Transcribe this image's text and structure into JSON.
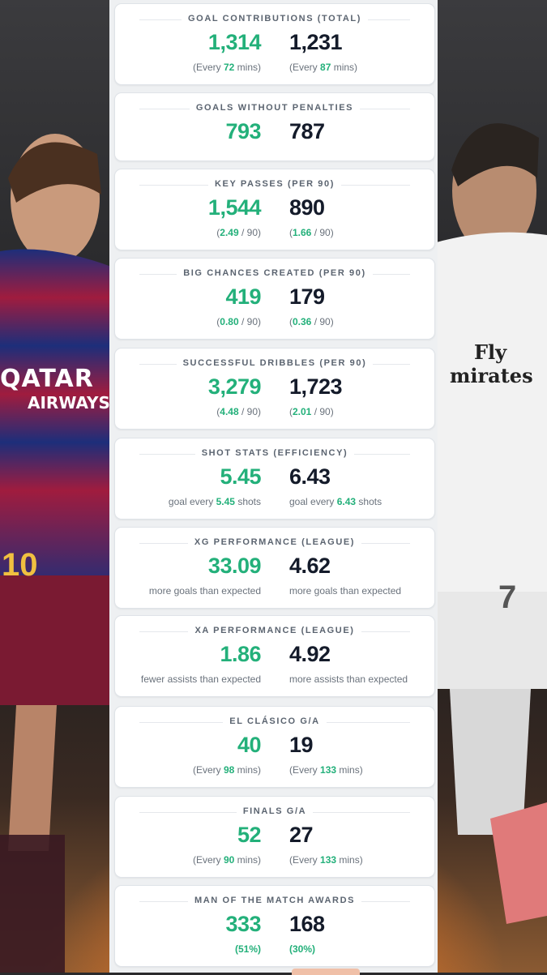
{
  "cards": [
    {
      "title": "GOAL CONTRIBUTIONS (TOTAL)",
      "left": "1,314",
      "right": "1,231",
      "left_sub": {
        "pre": "(Every ",
        "hl": "72",
        "post": " mins)"
      },
      "right_sub": {
        "pre": "(Every ",
        "hl": "87",
        "post": " mins)"
      }
    },
    {
      "title": "GOALS WITHOUT PENALTIES",
      "left": "793",
      "right": "787"
    },
    {
      "title": "KEY PASSES (PER 90)",
      "left": "1,544",
      "right": "890",
      "left_sub": {
        "pre": "(",
        "hl": "2.49",
        "post": " / 90)"
      },
      "right_sub": {
        "pre": "(",
        "hl": "1.66",
        "post": " / 90)"
      }
    },
    {
      "title": "BIG CHANCES CREATED (PER 90)",
      "left": "419",
      "right": "179",
      "left_sub": {
        "pre": "(",
        "hl": "0.80",
        "post": " / 90)"
      },
      "right_sub": {
        "pre": "(",
        "hl": "0.36",
        "post": " / 90)"
      }
    },
    {
      "title": "SUCCESSFUL DRIBBLES (PER 90)",
      "left": "3,279",
      "right": "1,723",
      "left_sub": {
        "pre": "(",
        "hl": "4.48",
        "post": " / 90)"
      },
      "right_sub": {
        "pre": "(",
        "hl": "2.01",
        "post": " / 90)"
      }
    },
    {
      "title": "SHOT STATS (EFFICIENCY)",
      "left": "5.45",
      "right": "6.43",
      "left_sub": {
        "pre": "goal every ",
        "hl": "5.45",
        "post": " shots"
      },
      "right_sub": {
        "pre": "goal every ",
        "hl": "6.43",
        "post": " shots"
      }
    },
    {
      "title": "XG PERFORMANCE (LEAGUE)",
      "left": "33.09",
      "right": "4.62",
      "left_sub": {
        "pre": "more goals than expected",
        "hl": "",
        "post": ""
      },
      "right_sub": {
        "pre": "more goals than expected",
        "hl": "",
        "post": ""
      }
    },
    {
      "title": "XA PERFORMANCE (LEAGUE)",
      "left": "1.86",
      "right": "4.92",
      "left_sub": {
        "pre": "fewer assists than expected",
        "hl": "",
        "post": ""
      },
      "right_sub": {
        "pre": "more assists than expected",
        "hl": "",
        "post": ""
      }
    },
    {
      "title": "EL CLÁSICO G/A",
      "left": "40",
      "right": "19",
      "left_sub": {
        "pre": "(Every ",
        "hl": "98",
        "post": " mins)"
      },
      "right_sub": {
        "pre": "(Every ",
        "hl": "133",
        "post": " mins)"
      }
    },
    {
      "title": "FINALS G/A",
      "left": "52",
      "right": "27",
      "left_sub": {
        "pre": "(Every ",
        "hl": "90",
        "post": " mins)"
      },
      "right_sub": {
        "pre": "(Every ",
        "hl": "133",
        "post": " mins)"
      }
    },
    {
      "title": "MAN OF THE MATCH AWARDS",
      "left": "333",
      "right": "168",
      "left_sub": {
        "pre": "",
        "hl": "(51%)",
        "post": ""
      },
      "right_sub": {
        "pre": "",
        "hl": "(30%)",
        "post": ""
      }
    }
  ],
  "colors": {
    "accent": "#23b07a",
    "dark": "#141b2a",
    "muted": "#6a727c"
  },
  "images": {
    "left_player": "Player in Barcelona kit (Qatar Airways sponsor)",
    "right_player": "Player in Real Madrid white kit (Fly Emirates sponsor)"
  },
  "left_kit_text": [
    "QATAR",
    "AIRWAYS"
  ],
  "right_kit_text": [
    "Fly",
    "mirates"
  ],
  "left_shirt_number": "10",
  "right_shirt_number": "7"
}
